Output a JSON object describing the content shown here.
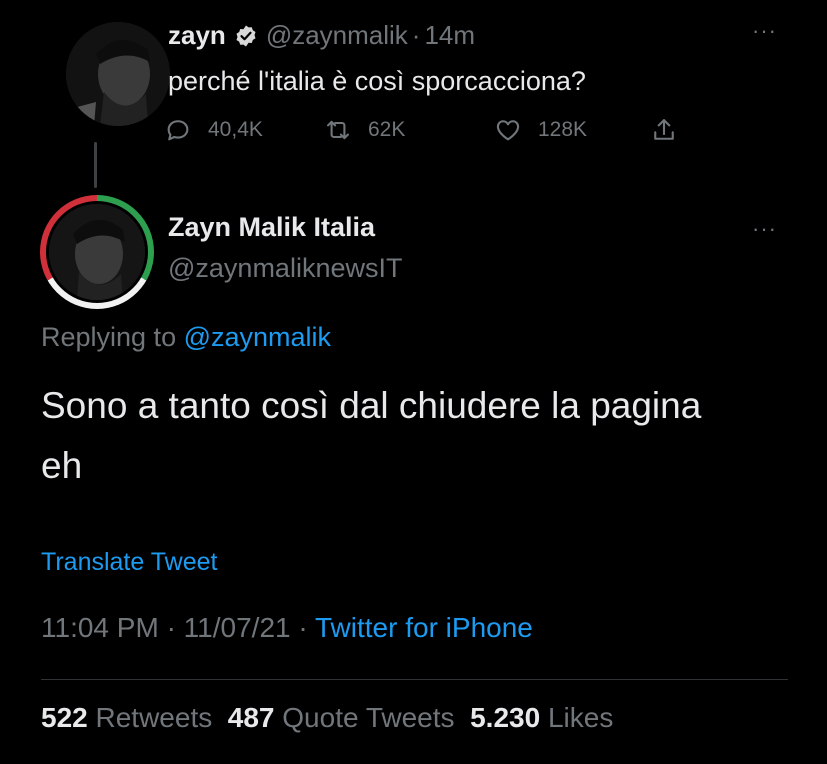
{
  "original_tweet": {
    "author_name": "zayn",
    "author_handle": "@zaynmalik",
    "separator": "·",
    "time_ago": "14m",
    "text": "perché l'italia è così sporcacciona?",
    "more_label": "···",
    "actions": {
      "replies": "40,4K",
      "retweets": "62K",
      "likes": "128K"
    }
  },
  "reply": {
    "author_name": "Zayn Malik Italia",
    "author_handle": "@zaynmaliknewsIT",
    "more_label": "···",
    "replying_prefix": "Replying to",
    "replying_to": "@zaynmalik",
    "text": "Sono a tanto così dal chiudere la pagina eh",
    "translate_label": "Translate Tweet",
    "time": "11:04 PM",
    "date": "11/07/21",
    "meta_separator": "·",
    "source": "Twitter for iPhone",
    "stats": {
      "retweets_count": "522",
      "retweets_label": "Retweets",
      "quotes_count": "487",
      "quotes_label": "Quote Tweets",
      "likes_count": "5.230",
      "likes_label": "Likes"
    }
  },
  "colors": {
    "background": "#000000",
    "text_primary": "#e7e9ea",
    "text_secondary": "#71767b",
    "link": "#1d9bf0",
    "verified": "#d9d9d9",
    "ring_green": "#2e9e4f",
    "ring_white": "#f2f2f2",
    "ring_red": "#d0303a"
  }
}
